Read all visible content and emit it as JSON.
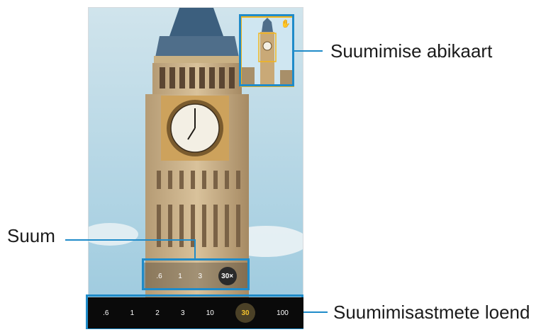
{
  "callouts": {
    "minimap_label": "Suumimise abikaart",
    "zoom_label": "Suum",
    "zoom_levels_label": "Suumimisastmete loend"
  },
  "zoom_control": {
    "options": [
      ".6",
      "1",
      "3"
    ],
    "active": "30×"
  },
  "zoom_steps": {
    "options": [
      ".6",
      "1",
      "2",
      "3",
      "10"
    ],
    "active": "30",
    "last": "100"
  },
  "colors": {
    "highlight": "#1f8bc9",
    "minimap_border": "#f2b51a",
    "active_step": "#f3c12d"
  },
  "icons": {
    "minimap_icon": "pan-hand-icon"
  }
}
